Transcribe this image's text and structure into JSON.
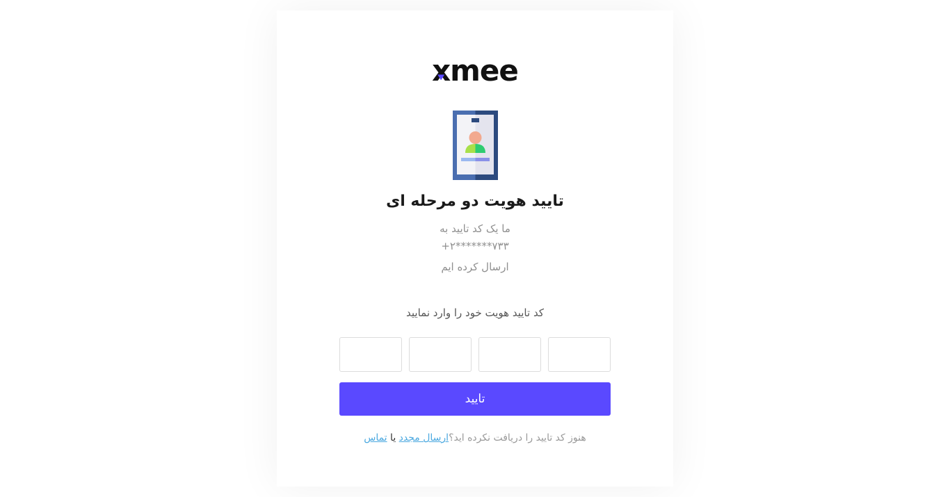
{
  "logo": {
    "text_x": "x",
    "text_rest": "mee"
  },
  "title": "تایید هویت دو مرحله ای",
  "description": {
    "line1": "ما یک کد تایید به",
    "phone": "+۲*******۷۳۳",
    "line3": "ارسال کرده ایم"
  },
  "code_label": "کد تایید هویت خود را وارد نمایید",
  "otp": {
    "digits": [
      "",
      "",
      "",
      ""
    ]
  },
  "submit_label": "تایید",
  "footer": {
    "question": "هنوز کد تایید را دریافت نکرده اید؟",
    "resend_link": "ارسال مجدد",
    "or": "یا",
    "contact_link": "تماس"
  },
  "colors": {
    "accent": "#5a49ff",
    "link": "#4aa8e0",
    "muted_text": "#8f8f8f"
  },
  "icons": [
    "id-card-illustration",
    "logo-x-mark"
  ]
}
